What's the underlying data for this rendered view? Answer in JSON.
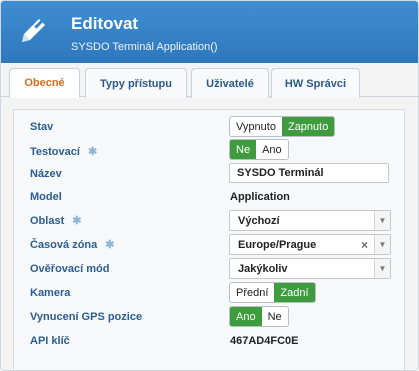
{
  "header": {
    "title": "Editovat",
    "subtitle": "SYSDO Terminál Application()",
    "icon": "pencil-icon"
  },
  "tabs": [
    {
      "label": "Obecné",
      "active": true
    },
    {
      "label": "Typy přístupu",
      "active": false
    },
    {
      "label": "Uživatelé",
      "active": false
    },
    {
      "label": "HW Správci",
      "active": false
    }
  ],
  "form": {
    "stav": {
      "label": "Stav",
      "options": [
        "Vypnuto",
        "Zapnuto"
      ],
      "selected": "Zapnuto"
    },
    "testovaci": {
      "label": "Testovací",
      "options": [
        "Ne",
        "Ano"
      ],
      "selected": "Ne",
      "has_gear": true
    },
    "nazev": {
      "label": "Název",
      "value": "SYSDO Terminál"
    },
    "model": {
      "label": "Model",
      "value": "Application"
    },
    "oblast": {
      "label": "Oblast",
      "value": "Výchozí",
      "has_gear": true
    },
    "casova_zona": {
      "label": "Časová zóna",
      "value": "Europe/Prague",
      "has_gear": true,
      "clear": "×"
    },
    "overovaci_mod": {
      "label": "Ověřovací mód",
      "value": "Jakýkoliv"
    },
    "kamera": {
      "label": "Kamera",
      "options": [
        "Přední",
        "Zadní"
      ],
      "selected": "Zadní"
    },
    "gps": {
      "label": "Vynucení GPS pozice",
      "options": [
        "Ano",
        "Ne"
      ],
      "selected": "Ano"
    },
    "api_key": {
      "label": "API klíč",
      "value": "467AD4FC0E"
    }
  },
  "colors": {
    "header": "#3a86cb",
    "toggle_on": "#3e9b3e",
    "label": "#2a5d92",
    "active_tab": "#d86c1a"
  }
}
